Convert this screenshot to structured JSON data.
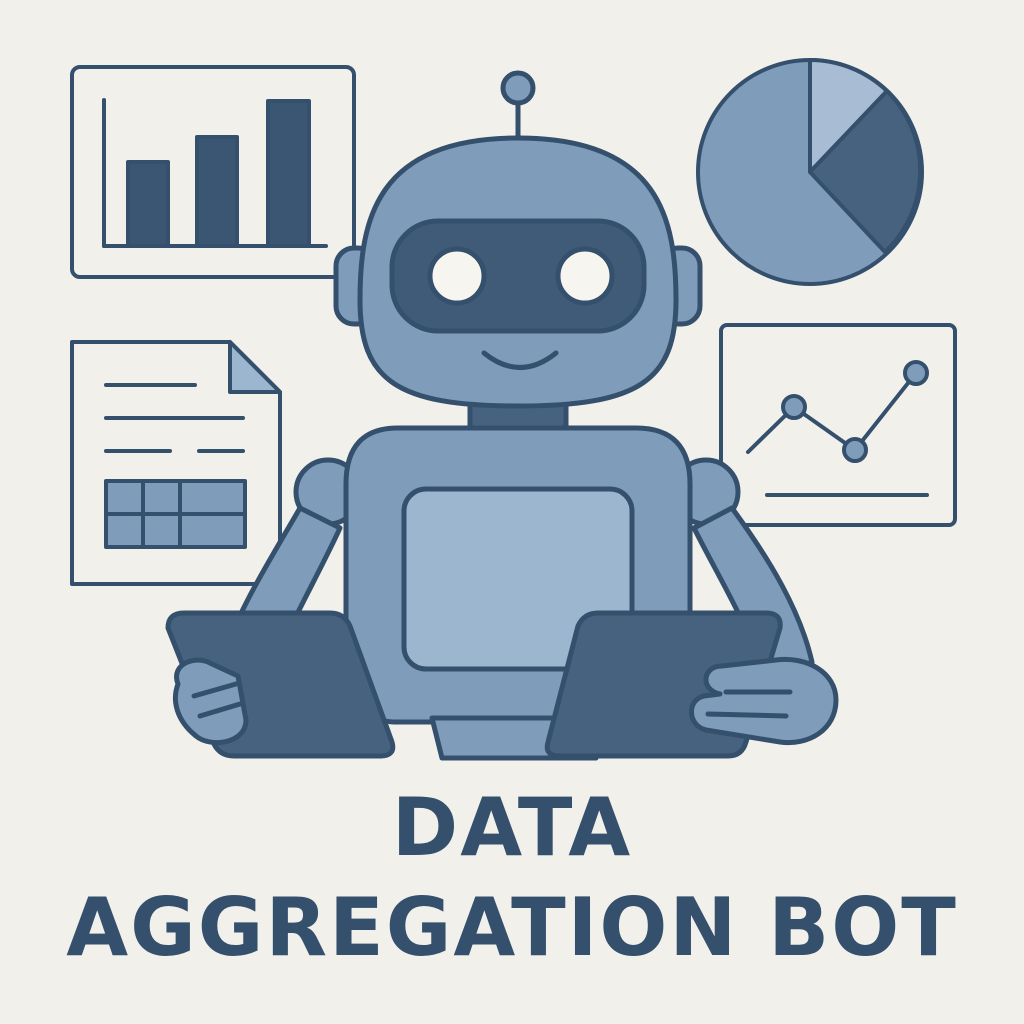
{
  "title": {
    "line1": "DATA",
    "line2": "AGGREGATION BOT"
  },
  "colors": {
    "background": "#f2f0eb",
    "outline": "#34506c",
    "robot_body": "#7f9dbb",
    "robot_light": "#9db6cf",
    "dark_fill": "#46627f",
    "visor": "#3f5b78",
    "eye": "#f7f5f0"
  },
  "icons": [
    "bar-chart-icon",
    "pie-chart-icon",
    "document-icon",
    "line-chart-icon",
    "robot-icon",
    "tablet-icon"
  ]
}
